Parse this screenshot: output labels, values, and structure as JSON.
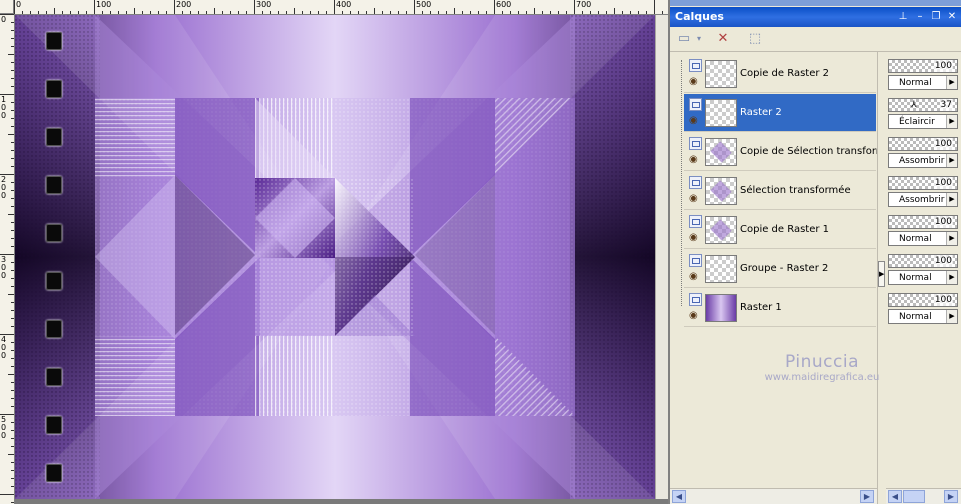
{
  "ruler": {
    "top_labels": [
      "0",
      "100",
      "200",
      "300",
      "400",
      "500",
      "600",
      "700"
    ],
    "left_labels": [
      "0",
      "1\n0\n0",
      "2\n0\n0",
      "3\n0\n0",
      "4\n0\n0",
      "5\n0\n0"
    ]
  },
  "panel": {
    "title": "Calques",
    "buttons": {
      "pin": "⊥",
      "minimize": "–",
      "restore": "❐",
      "close": "✕"
    }
  },
  "layers": [
    {
      "name": "Copie de Raster 2",
      "opacity": "100",
      "blend": "Normal",
      "selected": false,
      "thumb": "transparent"
    },
    {
      "name": "Raster 2",
      "opacity": "37",
      "blend": "Éclaircir",
      "selected": true,
      "thumb": "transparent"
    },
    {
      "name": "Copie de Sélection transformée",
      "opacity": "100",
      "blend": "Assombrir",
      "selected": false,
      "thumb": "blob"
    },
    {
      "name": "Sélection transformée",
      "opacity": "100",
      "blend": "Assombrir",
      "selected": false,
      "thumb": "blob"
    },
    {
      "name": "Copie de Raster 1",
      "opacity": "100",
      "blend": "Normal",
      "selected": false,
      "thumb": "blob"
    },
    {
      "name": "Groupe - Raster 2",
      "opacity": "100",
      "blend": "Normal",
      "selected": false,
      "thumb": "transparent"
    },
    {
      "name": "Raster 1",
      "opacity": "100",
      "blend": "Normal",
      "selected": false,
      "thumb": "purple"
    }
  ],
  "watermark": {
    "name": "Pinuccia",
    "url": "www.maidiregrafica.eu"
  },
  "colors": {
    "selection": "#316ac5",
    "titlebar": "#0a4fc7",
    "purple_dark": "#2a0e4e",
    "purple_mid": "#8a5cc4",
    "purple_light": "#d9c8f2"
  }
}
